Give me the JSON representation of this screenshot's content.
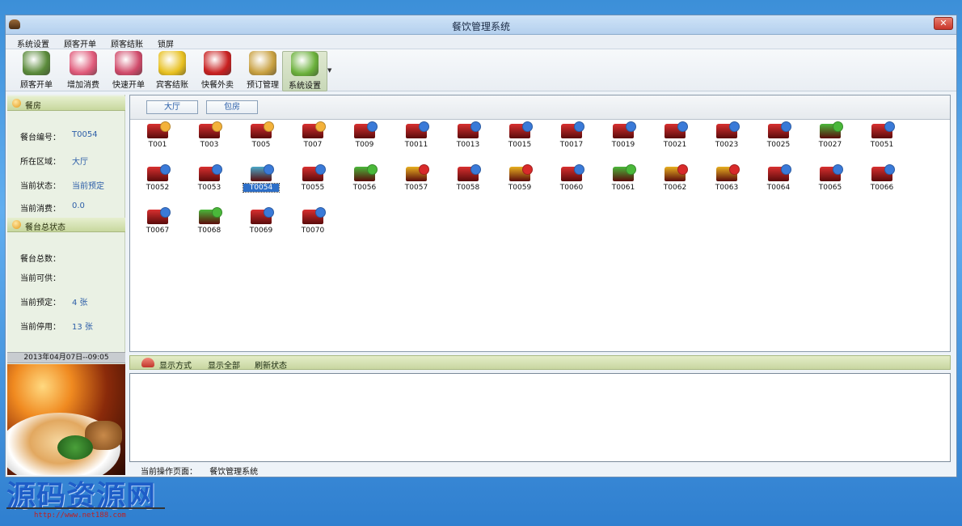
{
  "window": {
    "title": "餐饮管理系统",
    "close_glyph": "✕"
  },
  "menu": [
    "系统设置",
    "顾客开单",
    "顾客结账",
    "锁屏"
  ],
  "toolbar": [
    {
      "label": "顾客开单",
      "icon": "coffee-cup-icon",
      "color": "#5a8a3a"
    },
    {
      "label": "增加消费",
      "icon": "add-plus-icon",
      "color": "#e05a7a"
    },
    {
      "label": "快速开单",
      "icon": "pencil-icon",
      "color": "#d04a6a"
    },
    {
      "label": "宾客结账",
      "icon": "money-arrow-icon",
      "color": "#e8c020"
    },
    {
      "label": "快餐外卖",
      "icon": "takeout-bowl-icon",
      "color": "#c82020"
    },
    {
      "label": "预订管理",
      "icon": "clock-icon",
      "color": "#c8a040"
    },
    {
      "label": "系统设置",
      "icon": "gears-icon",
      "color": "#6ab03a"
    }
  ],
  "left": {
    "section1_title": "餐房",
    "rows1": [
      {
        "label": "餐台编号：",
        "value": "T0054"
      },
      {
        "label": "所在区域：",
        "value": "大厅"
      },
      {
        "label": "当前状态：",
        "value": "当前预定"
      },
      {
        "label": "当前消费：",
        "value": "0.0"
      }
    ],
    "section2_title": "餐台总状态",
    "rows2": [
      {
        "label": "餐台总数：",
        "value": ""
      },
      {
        "label": "当前可供：",
        "value": ""
      },
      {
        "label": "当前预定：",
        "value": "4   张"
      },
      {
        "label": "当前停用：",
        "value": "13  张"
      }
    ],
    "datetime": "2013年04月07日--09:05"
  },
  "areas": [
    "大厅",
    "包房"
  ],
  "status_colors": {
    "reserved": "#f4b23a",
    "free": "#3a7ad8",
    "available": "#4ab83a",
    "disabled": "#d82a2a"
  },
  "tables": [
    {
      "id": "T001",
      "status": "reserved",
      "body": "#d83030"
    },
    {
      "id": "T003",
      "status": "reserved",
      "body": "#d83030"
    },
    {
      "id": "T005",
      "status": "reserved",
      "body": "#d83030"
    },
    {
      "id": "T007",
      "status": "reserved",
      "body": "#d83030"
    },
    {
      "id": "T009",
      "status": "free",
      "body": "#d83030"
    },
    {
      "id": "T0011",
      "status": "free",
      "body": "#d83030"
    },
    {
      "id": "T0013",
      "status": "free",
      "body": "#d83030"
    },
    {
      "id": "T0015",
      "status": "free",
      "body": "#d83030"
    },
    {
      "id": "T0017",
      "status": "free",
      "body": "#d83030"
    },
    {
      "id": "T0019",
      "status": "free",
      "body": "#d83030"
    },
    {
      "id": "T0021",
      "status": "free",
      "body": "#d83030"
    },
    {
      "id": "T0023",
      "status": "free",
      "body": "#d83030"
    },
    {
      "id": "T0025",
      "status": "free",
      "body": "#d83030"
    },
    {
      "id": "T0027",
      "status": "available",
      "body": "#4ab83a"
    },
    {
      "id": "T0051",
      "status": "free",
      "body": "#d83030"
    },
    {
      "id": "T0052",
      "status": "free",
      "body": "#d83030"
    },
    {
      "id": "T0053",
      "status": "free",
      "body": "#d83030"
    },
    {
      "id": "T0054",
      "status": "free",
      "body": "#4aa8c8",
      "selected": true
    },
    {
      "id": "T0055",
      "status": "free",
      "body": "#d83030"
    },
    {
      "id": "T0056",
      "status": "available",
      "body": "#4ab83a"
    },
    {
      "id": "T0057",
      "status": "disabled",
      "body": "#e8b020"
    },
    {
      "id": "T0058",
      "status": "free",
      "body": "#d83030"
    },
    {
      "id": "T0059",
      "status": "disabled",
      "body": "#e8b020"
    },
    {
      "id": "T0060",
      "status": "free",
      "body": "#d83030"
    },
    {
      "id": "T0061",
      "status": "available",
      "body": "#4ab83a"
    },
    {
      "id": "T0062",
      "status": "disabled",
      "body": "#e8b020"
    },
    {
      "id": "T0063",
      "status": "disabled",
      "body": "#e8b020"
    },
    {
      "id": "T0064",
      "status": "free",
      "body": "#d83030"
    },
    {
      "id": "T0065",
      "status": "free",
      "body": "#d83030"
    },
    {
      "id": "T0066",
      "status": "free",
      "body": "#d83030"
    },
    {
      "id": "T0067",
      "status": "free",
      "body": "#d83030"
    },
    {
      "id": "T0068",
      "status": "available",
      "body": "#4ab83a"
    },
    {
      "id": "T0069",
      "status": "free",
      "body": "#d83030"
    },
    {
      "id": "T0070",
      "status": "free",
      "body": "#d83030"
    }
  ],
  "bottom": {
    "buttons": [
      "显示方式",
      "显示全部",
      "刷新状态"
    ],
    "status_label": "当前操作页面：",
    "status_value": "餐饮管理系统"
  },
  "watermark": {
    "text": "源码资源网",
    "url": "http://www.net188.com"
  }
}
